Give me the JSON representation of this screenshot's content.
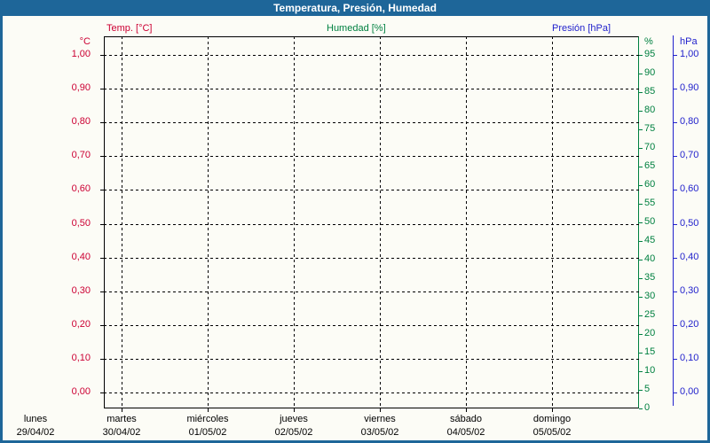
{
  "window": {
    "title": "Temperatura, Presión, Humedad"
  },
  "legend": {
    "temp": "Temp. [°C]",
    "humidity": "Humedad [%]",
    "pressure": "Presión [hPa]"
  },
  "colors": {
    "temp": "#cc0033",
    "humidity": "#008040",
    "pressure": "#2222cc",
    "title_bg": "#1e6699",
    "page_bg": "#fcfcf6",
    "grid": "#000000"
  },
  "axes": {
    "left": {
      "unit": "°C",
      "ticks": [
        "1,00",
        "0,90",
        "0,80",
        "0,70",
        "0,60",
        "0,50",
        "0,40",
        "0,30",
        "0,20",
        "0,10",
        "0,00"
      ]
    },
    "right_percent": {
      "unit": "%",
      "ticks": [
        "95",
        "90",
        "85",
        "80",
        "75",
        "70",
        "65",
        "60",
        "55",
        "50",
        "45",
        "40",
        "35",
        "30",
        "25",
        "20",
        "15",
        "10",
        "5",
        "0"
      ]
    },
    "right_pressure": {
      "unit": "hPa",
      "ticks": [
        "1,00",
        "0,90",
        "0,80",
        "0,70",
        "0,60",
        "0,50",
        "0,40",
        "0,30",
        "0,20",
        "0,10",
        "0,00"
      ]
    }
  },
  "x_axis": {
    "days": [
      {
        "name": "lunes",
        "date": "29/04/02"
      },
      {
        "name": "martes",
        "date": "30/04/02"
      },
      {
        "name": "miércoles",
        "date": "01/05/02"
      },
      {
        "name": "jueves",
        "date": "02/05/02"
      },
      {
        "name": "viernes",
        "date": "03/05/02"
      },
      {
        "name": "sábado",
        "date": "04/05/02"
      },
      {
        "name": "domingo",
        "date": "05/05/02"
      }
    ]
  },
  "chart_data": {
    "type": "line",
    "title": "Temperatura, Presión, Humedad",
    "x": [
      "29/04/02",
      "30/04/02",
      "01/05/02",
      "02/05/02",
      "03/05/02",
      "04/05/02",
      "05/05/02"
    ],
    "x_tick_labels": [
      "lunes",
      "martes",
      "miércoles",
      "jueves",
      "viernes",
      "sábado",
      "domingo"
    ],
    "series": [
      {
        "name": "Temp. [°C]",
        "y_axis": "left",
        "color": "#cc0033",
        "values": []
      },
      {
        "name": "Humedad [%]",
        "y_axis": "right_percent",
        "color": "#008040",
        "values": []
      },
      {
        "name": "Presión [hPa]",
        "y_axis": "right_pressure",
        "color": "#2222cc",
        "values": []
      }
    ],
    "left_axis": {
      "label": "°C",
      "range": [
        0.0,
        1.0
      ],
      "step": 0.1
    },
    "right_percent_axis": {
      "label": "%",
      "range": [
        0,
        100
      ],
      "step": 5
    },
    "right_pressure_axis": {
      "label": "hPa",
      "range": [
        0.0,
        1.0
      ],
      "step": 0.1
    },
    "grid": true,
    "legend_position": "top",
    "note": "empty chart — no data points plotted"
  }
}
